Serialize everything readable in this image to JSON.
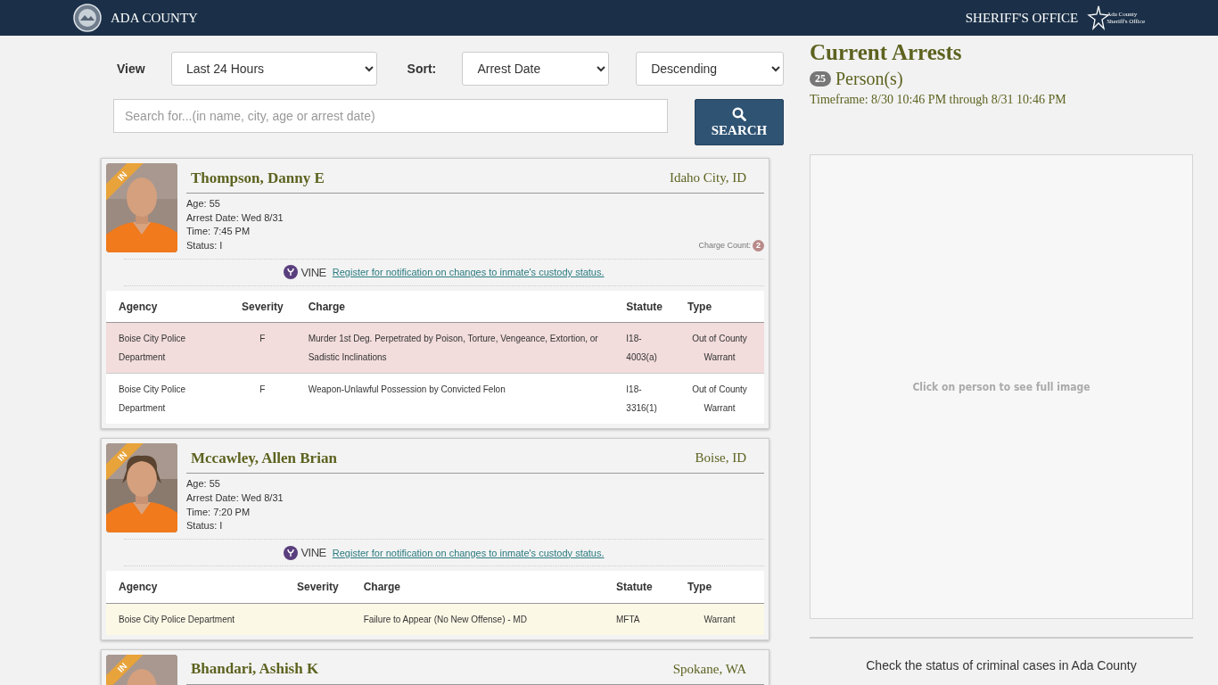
{
  "header": {
    "title": "ADA COUNTY",
    "office": "SHERIFF'S OFFICE",
    "logo_lines": [
      "Ada County",
      "Sheriff's Office"
    ]
  },
  "filters": {
    "view_label": "View",
    "view_value": "Last 24 Hours",
    "sort_label": "Sort:",
    "sort_value": "Arrest Date",
    "order_value": "Descending",
    "search_placeholder": "Search for...(in name, city, age or arrest date)",
    "search_button": "SEARCH"
  },
  "inmates": [
    {
      "badge": "IN",
      "name": "Thompson, Danny E",
      "location": "Idaho City, ID",
      "details": [
        "Age: 55",
        "Arrest Date: Wed 8/31",
        "Time: 7:45 PM",
        "Status: I"
      ],
      "charge_count_label": "Charge Count:",
      "charge_count": "2",
      "vine": "VINE",
      "vine_link": "Register for notification on changes to inmate's custody status.",
      "columns": [
        "Agency",
        "Severity",
        "Charge",
        "Statute",
        "Type"
      ],
      "charges": [
        {
          "agency": "Boise City Police Department",
          "severity": "F",
          "charge": "Murder 1st Deg. Perpetrated by Poison, Torture, Vengeance, Extortion, or Sadistic Inclinations",
          "statute": "I18-4003(a)",
          "type": "Out of County Warrant",
          "color": "#f2dcdc"
        },
        {
          "agency": "Boise City Police Department",
          "severity": "F",
          "charge": "Weapon-Unlawful Possession by Convicted Felon",
          "statute": "I18-3316(1)",
          "type": "Out of County Warrant",
          "color": "#ffffff"
        }
      ]
    },
    {
      "badge": "IN",
      "name": "Mccawley, Allen Brian",
      "location": "Boise, ID",
      "details": [
        "Age: 55",
        "Arrest Date: Wed 8/31",
        "Time: 7:20 PM",
        "Status: I"
      ],
      "vine": "VINE",
      "vine_link": "Register for notification on changes to inmate's custody status.",
      "columns": [
        "Agency",
        "Severity",
        "Charge",
        "Statute",
        "Type"
      ],
      "charges": [
        {
          "agency": "Boise City Police Department",
          "charge": "Failure to Appear (No New Offense) - MD",
          "statute": "MFTA",
          "type": "Warrant",
          "color": "#fcf8e6"
        }
      ]
    },
    {
      "badge": "IN",
      "name": "Bhandari, Ashish K",
      "location": "Spokane, WA"
    }
  ],
  "summary": {
    "title": "Current Arrests",
    "count": "25",
    "count_label": "Person(s)",
    "timeframe": "Timeframe: 8/30 10:46 PM through 8/31 10:46 PM"
  },
  "image_panel": {
    "placeholder": "Click on person to see full image"
  },
  "footer_text": "Check the status of criminal cases in Ada County"
}
